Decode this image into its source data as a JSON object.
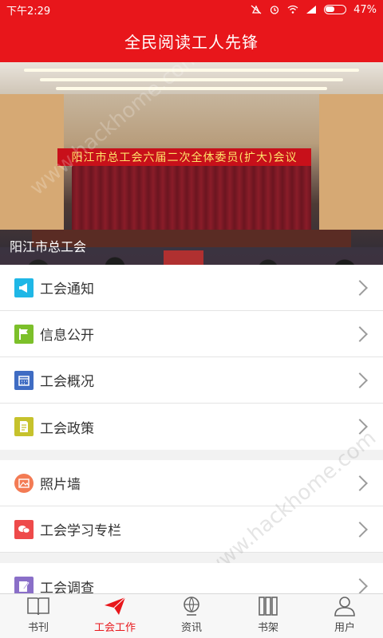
{
  "status": {
    "time": "下午2:29",
    "battery": "47%"
  },
  "app": {
    "title": "全民阅读工人先锋"
  },
  "banner": {
    "sign_text": "阳江市总工会六届二次全体委员(扩大)会议",
    "caption": "阳江市总工会"
  },
  "menu_group_1": [
    {
      "label": "工会通知",
      "icon": "megaphone-icon",
      "color": "#1fb7e6"
    },
    {
      "label": "信息公开",
      "icon": "flag-icon",
      "color": "#7cc02a"
    },
    {
      "label": "工会概况",
      "icon": "calendar-icon",
      "color": "#3f6cc3"
    },
    {
      "label": "工会政策",
      "icon": "document-icon",
      "color": "#c6c22c"
    }
  ],
  "menu_group_2": [
    {
      "label": "照片墙",
      "icon": "photo-icon",
      "color": "#f37b54"
    },
    {
      "label": "工会学习专栏",
      "icon": "chat-icon",
      "color": "#ee4a4a"
    }
  ],
  "menu_group_3": [
    {
      "label": "工会调查",
      "icon": "edit-icon",
      "color": "#8a6fc8"
    }
  ],
  "tabs": [
    {
      "label": "书刊",
      "icon": "book-icon",
      "active": false
    },
    {
      "label": "工会工作",
      "icon": "paper-plane-icon",
      "active": true
    },
    {
      "label": "资讯",
      "icon": "globe-icon",
      "active": false
    },
    {
      "label": "书架",
      "icon": "bookshelf-icon",
      "active": false
    },
    {
      "label": "用户",
      "icon": "user-icon",
      "active": false
    }
  ],
  "watermark": "www.hackhome.com",
  "colors": {
    "brand_red": "#e8161b"
  }
}
